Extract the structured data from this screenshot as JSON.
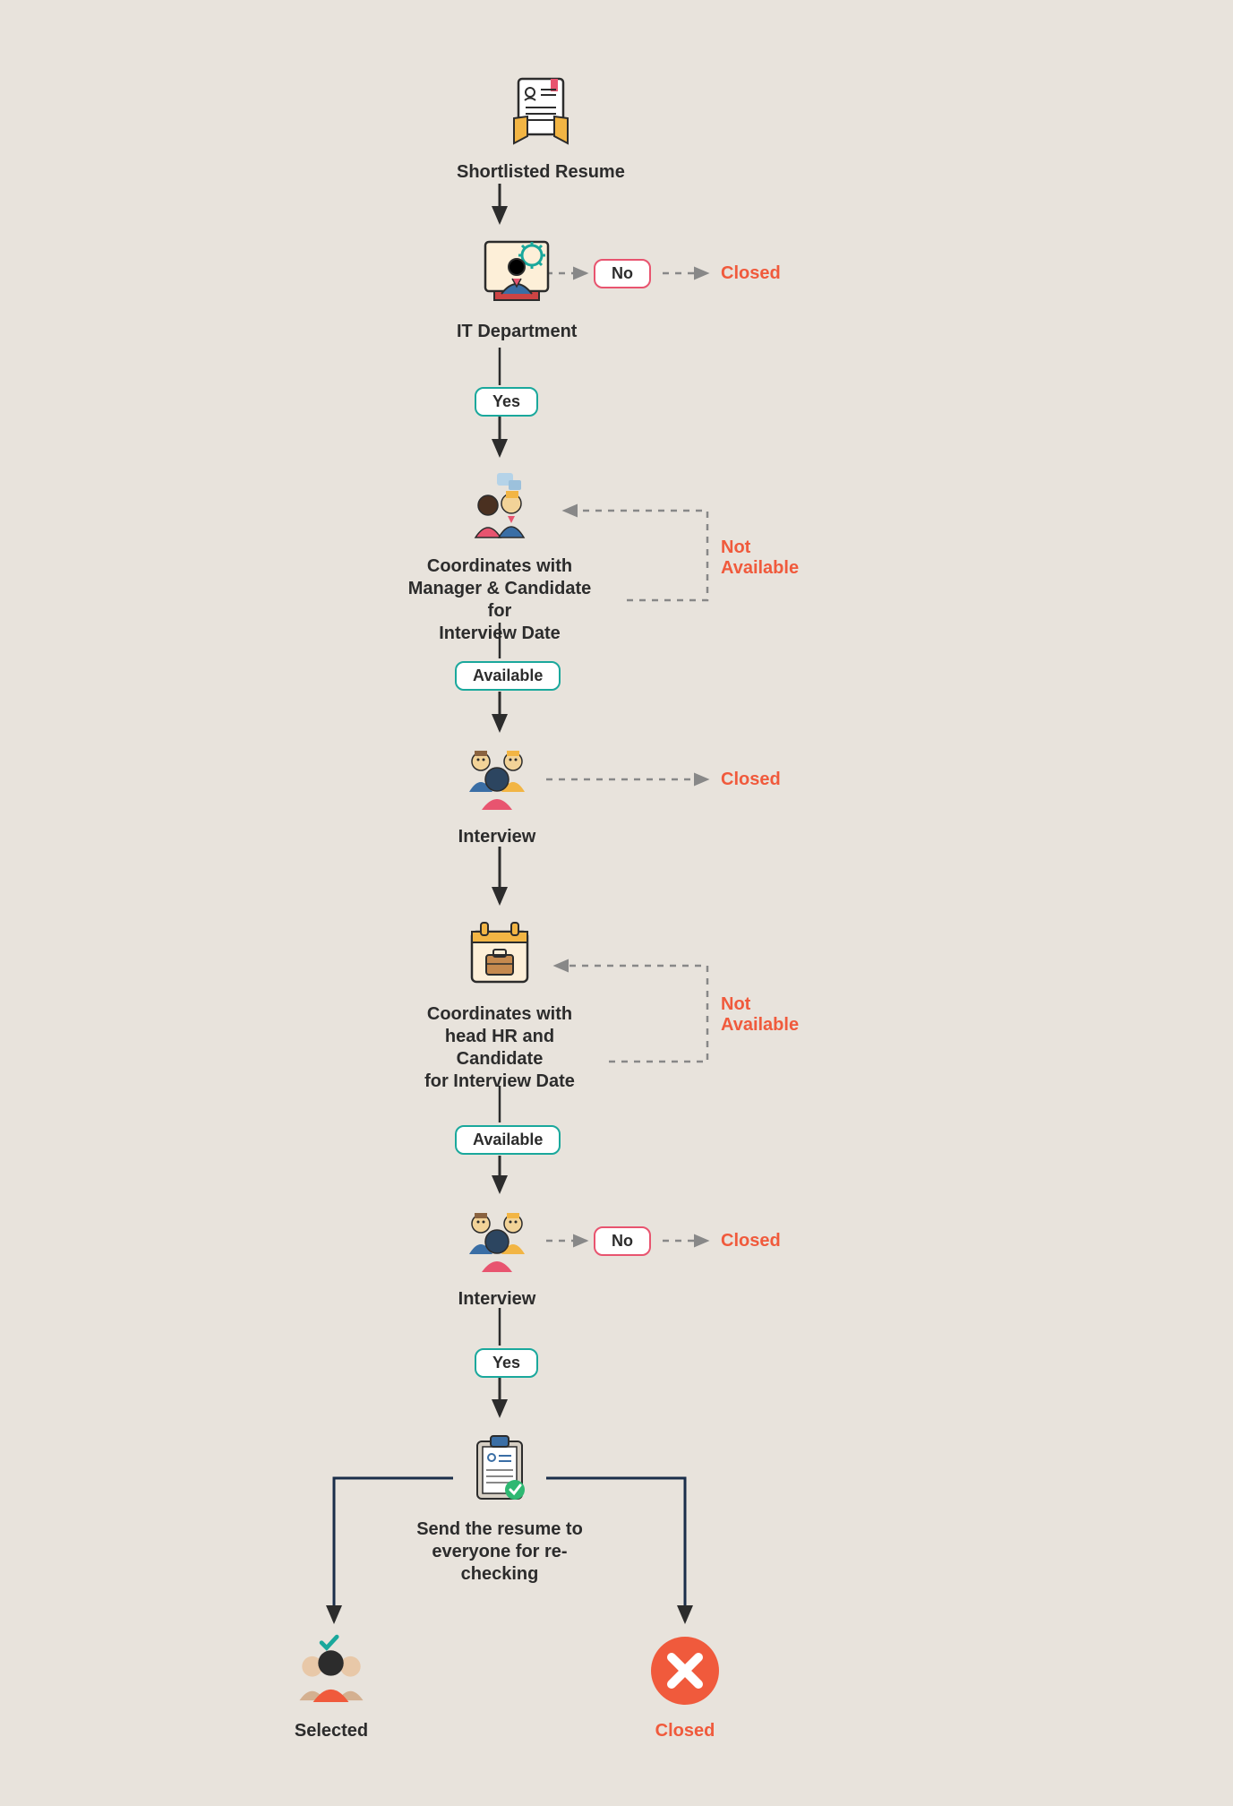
{
  "nodes": {
    "resume": {
      "label": "Shortlisted Resume"
    },
    "it": {
      "label": "IT Department"
    },
    "coord1_l1": "Coordinates with",
    "coord1_l2": "Manager & Candidate for",
    "coord1_l3": "Interview Date",
    "interview1": {
      "label": "Interview"
    },
    "coord2_l1": "Coordinates with",
    "coord2_l2": "head HR and Candidate",
    "coord2_l3": "for Interview Date",
    "interview2": {
      "label": "Interview"
    },
    "send_l1": "Send the resume to",
    "send_l2": "everyone for re-checking",
    "selected": {
      "label": "Selected"
    },
    "closed_final": {
      "label": "Closed"
    }
  },
  "pills": {
    "no1": "No",
    "yes1": "Yes",
    "avail1": "Available",
    "avail2": "Available",
    "no2": "No",
    "yes2": "Yes"
  },
  "labels": {
    "closed1": "Closed",
    "closed2": "Closed",
    "closed3": "Closed",
    "not_avail": "Not\nAvailable"
  }
}
